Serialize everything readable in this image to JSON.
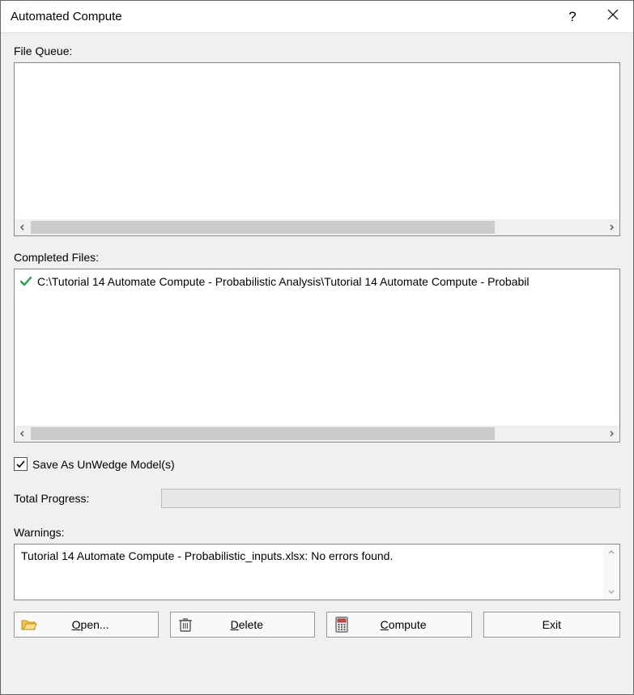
{
  "window": {
    "title": "Automated Compute"
  },
  "labels": {
    "file_queue": "File Queue:",
    "completed_files": "Completed Files:",
    "save_as_unwedge": "Save As UnWedge Model(s)",
    "total_progress": "Total Progress:",
    "warnings": "Warnings:"
  },
  "file_queue": {
    "items": []
  },
  "completed": {
    "items": [
      {
        "status": "success",
        "path": "C:\\Tutorial 14 Automate Compute - Probabilistic Analysis\\Tutorial 14 Automate Compute - Probabil"
      }
    ]
  },
  "save_as_unwedge_checked": true,
  "progress": {
    "value": 0
  },
  "warnings_list": [
    "Tutorial 14 Automate Compute - Probabilistic_inputs.xlsx: No errors found."
  ],
  "buttons": {
    "open": "Open...",
    "open_ul_index": 0,
    "delete": "Delete",
    "delete_ul_index": 0,
    "compute": "Compute",
    "compute_ul_index": 0,
    "exit": "Exit"
  }
}
